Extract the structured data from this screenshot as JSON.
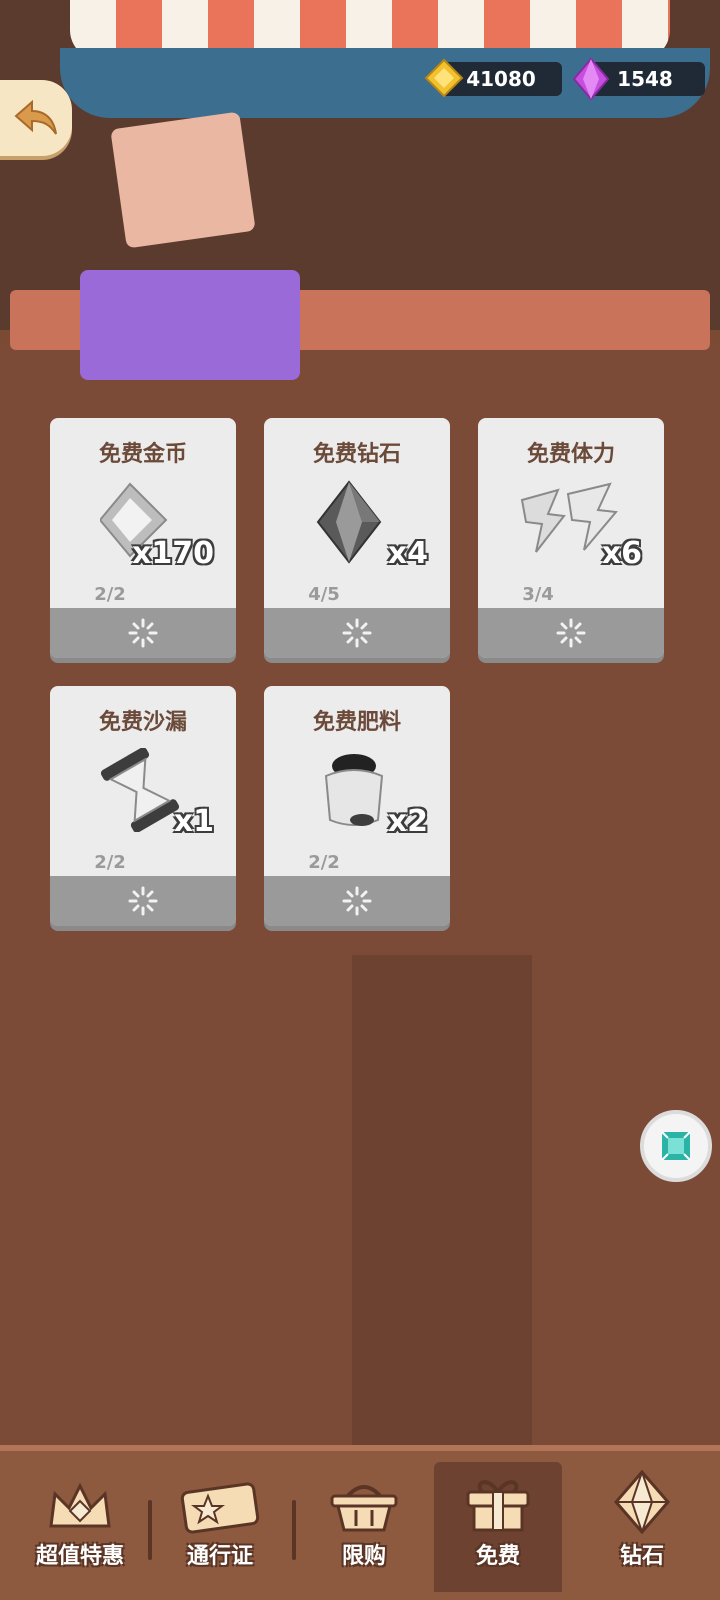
{
  "hud": {
    "gold_amount": "41080",
    "gem_amount": "1548",
    "gold_icon": "coin-icon",
    "gem_icon": "diamond-icon"
  },
  "cards": [
    {
      "title": "免费金币",
      "qty": "x170",
      "count": "2/2",
      "icon": "coin-icon"
    },
    {
      "title": "免费钻石",
      "qty": "x4",
      "count": "4/5",
      "icon": "diamond-icon"
    },
    {
      "title": "免费体力",
      "qty": "x6",
      "count": "3/4",
      "icon": "energy-icon"
    },
    {
      "title": "免费沙漏",
      "qty": "x1",
      "count": "2/2",
      "icon": "hourglass-icon"
    },
    {
      "title": "免费肥料",
      "qty": "x2",
      "count": "2/2",
      "icon": "fertilizer-icon"
    }
  ],
  "tabs": [
    {
      "label": "超值特惠",
      "icon": "crown-icon"
    },
    {
      "label": "通行证",
      "icon": "ticket-icon"
    },
    {
      "label": "限购",
      "icon": "basket-icon"
    },
    {
      "label": "免费",
      "icon": "gift-icon"
    },
    {
      "label": "钻石",
      "icon": "diamond-icon"
    }
  ],
  "colors": {
    "wood": "#7b4b38",
    "card": "#ececec",
    "accent_gold": "#f2c12e",
    "accent_gem": "#c64fe0"
  }
}
